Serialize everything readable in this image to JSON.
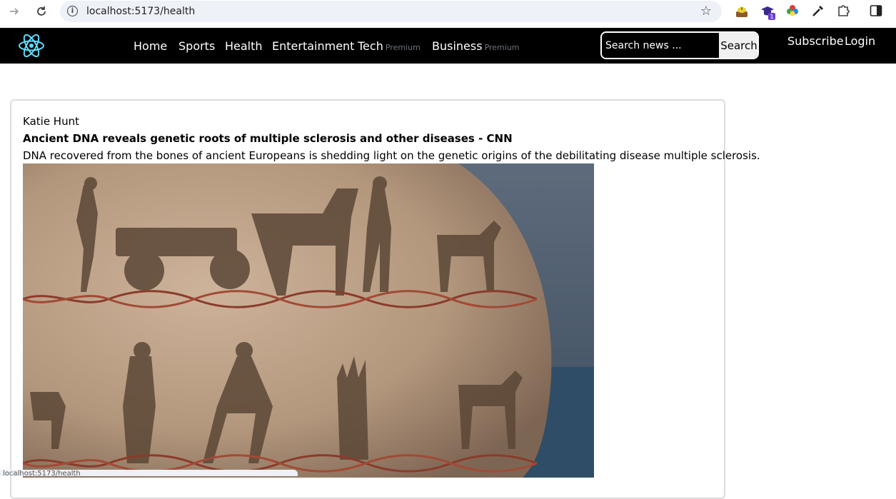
{
  "browser": {
    "url": "localhost:5173/health",
    "status_url": "localhost:5173/health"
  },
  "navbar": {
    "links": [
      {
        "label": "Home"
      },
      {
        "label": "Sports"
      },
      {
        "label": "Health"
      },
      {
        "label": "Entertainment"
      },
      {
        "label": "Tech",
        "badge": "Premium"
      },
      {
        "label": "Business",
        "badge": "Premium"
      }
    ],
    "search": {
      "placeholder": "Search news ...",
      "button": "Search"
    },
    "subscribe": "Subscribe",
    "login": "Login"
  },
  "article": {
    "author": "Katie Hunt",
    "title": "Ancient DNA reveals genetic roots of multiple sclerosis and other diseases - CNN",
    "description": "DNA recovered from the bones of ancient Europeans is shedding light on the genetic origins of the debilitating disease multiple sclerosis."
  },
  "colors": {
    "navbar_bg": "#000000",
    "logo": "#61dafb",
    "premium": "#6c757d"
  }
}
